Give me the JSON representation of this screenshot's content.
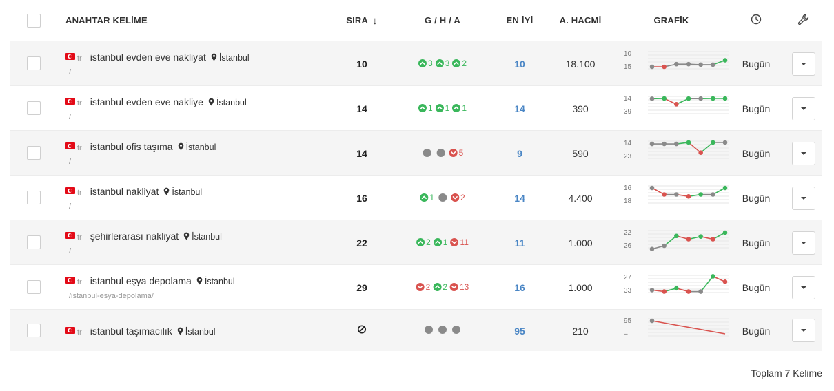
{
  "header": {
    "keyword": "ANAHTAR KELİME",
    "rank": "SIRA",
    "gha": "G / H / A",
    "best": "EN İYİ",
    "volume": "A. HACMİ",
    "graph": "GRAFİK",
    "clock_icon": "clock-icon",
    "wrench_icon": "wrench-icon",
    "sort_icon": "sort-down-arrow-icon"
  },
  "colors": {
    "up": "#3ab75b",
    "down": "#d9534f",
    "neutral": "#8a8a8a",
    "best": "#4a86c5",
    "flag": "#e30a17"
  },
  "rows": [
    {
      "lang": "tr",
      "keyword": "istanbul evden eve nakliyat",
      "location": "İstanbul",
      "path": "/",
      "rank": "10",
      "changes": [
        {
          "dir": "up",
          "value": "3"
        },
        {
          "dir": "up",
          "value": "3"
        },
        {
          "dir": "up",
          "value": "2"
        }
      ],
      "best": "10",
      "volume": "18.100",
      "spark": {
        "top": "10",
        "bottom": "15",
        "values": [
          15,
          15,
          14,
          14,
          14.2,
          14.2,
          12.5
        ],
        "dir": [
          "down",
          "neutral",
          "neutral",
          "neutral",
          "neutral",
          "up"
        ],
        "min": 10,
        "max": 15
      },
      "date": "Bugün"
    },
    {
      "lang": "tr",
      "keyword": "istanbul evden eve nakliye",
      "location": "İstanbul",
      "path": "/",
      "rank": "14",
      "changes": [
        {
          "dir": "up",
          "value": "1"
        },
        {
          "dir": "up",
          "value": "1"
        },
        {
          "dir": "up",
          "value": "1"
        }
      ],
      "best": "14",
      "volume": "390",
      "spark": {
        "top": "14",
        "bottom": "39",
        "values": [
          14.5,
          14,
          25,
          14.2,
          14.2,
          14,
          14
        ],
        "dir": [
          "up",
          "down",
          "up",
          "neutral",
          "up",
          "up"
        ],
        "min": 14,
        "max": 39
      },
      "date": "Bugün"
    },
    {
      "lang": "tr",
      "keyword": "istanbul ofis taşıma",
      "location": "İstanbul",
      "path": "/",
      "rank": "14",
      "changes": [
        {
          "dir": "neutral",
          "value": ""
        },
        {
          "dir": "neutral",
          "value": ""
        },
        {
          "dir": "down",
          "value": "5"
        }
      ],
      "best": "9",
      "volume": "590",
      "spark": {
        "top": "14",
        "bottom": "23",
        "values": [
          14.5,
          14.5,
          14.5,
          13.5,
          20.5,
          13.5,
          13.5
        ],
        "dir": [
          "neutral",
          "neutral",
          "up",
          "down",
          "up",
          "neutral"
        ],
        "min": 14,
        "max": 23
      },
      "date": "Bugün"
    },
    {
      "lang": "tr",
      "keyword": "istanbul nakliyat",
      "location": "İstanbul",
      "path": "/",
      "rank": "16",
      "changes": [
        {
          "dir": "up",
          "value": "1"
        },
        {
          "dir": "neutral",
          "value": ""
        },
        {
          "dir": "down",
          "value": "2"
        }
      ],
      "best": "14",
      "volume": "4.400",
      "spark": {
        "top": "16",
        "bottom": "18",
        "values": [
          16,
          17,
          17,
          17.3,
          17,
          17,
          16
        ],
        "dir": [
          "down",
          "neutral",
          "down",
          "up",
          "neutral",
          "up"
        ],
        "min": 16,
        "max": 18
      },
      "date": "Bugün"
    },
    {
      "lang": "tr",
      "keyword": "şehirlerarası nakliyat",
      "location": "İstanbul",
      "path": "/",
      "rank": "22",
      "changes": [
        {
          "dir": "up",
          "value": "2"
        },
        {
          "dir": "up",
          "value": "1"
        },
        {
          "dir": "down",
          "value": "11"
        }
      ],
      "best": "11",
      "volume": "1.000",
      "spark": {
        "top": "22",
        "bottom": "26",
        "values": [
          27,
          26,
          23,
          24,
          23.2,
          24,
          22
        ],
        "dir": [
          "neutral",
          "up",
          "down",
          "up",
          "down",
          "up"
        ],
        "min": 22,
        "max": 26
      },
      "date": "Bugün"
    },
    {
      "lang": "tr",
      "keyword": "istanbul eşya depolama",
      "location": "İstanbul",
      "path": "/istanbul-esya-depolama/",
      "rank": "29",
      "changes": [
        {
          "dir": "down",
          "value": "2"
        },
        {
          "dir": "up",
          "value": "2"
        },
        {
          "dir": "down",
          "value": "13"
        }
      ],
      "best": "16",
      "volume": "1.000",
      "spark": {
        "top": "27",
        "bottom": "33",
        "values": [
          32.8,
          33.5,
          32,
          33.5,
          33.5,
          26.5,
          29
        ],
        "dir": [
          "down",
          "up",
          "down",
          "neutral",
          "up",
          "down"
        ],
        "min": 27,
        "max": 33
      },
      "date": "Bugün"
    },
    {
      "lang": "tr",
      "keyword": "istanbul taşımacılık",
      "location": "İstanbul",
      "path": "",
      "rank_icon": "not-ranked-icon",
      "changes": [
        {
          "dir": "neutral",
          "value": ""
        },
        {
          "dir": "neutral",
          "value": ""
        },
        {
          "dir": "neutral",
          "value": ""
        }
      ],
      "best": "95",
      "volume": "210",
      "spark": {
        "top": "95",
        "bottom": "–",
        "values": [
          95,
          100
        ],
        "dir": [
          "down"
        ],
        "min": 95,
        "max": 100
      },
      "date": "Bugün"
    }
  ],
  "footer": {
    "total": "Toplam 7 Kelime"
  }
}
